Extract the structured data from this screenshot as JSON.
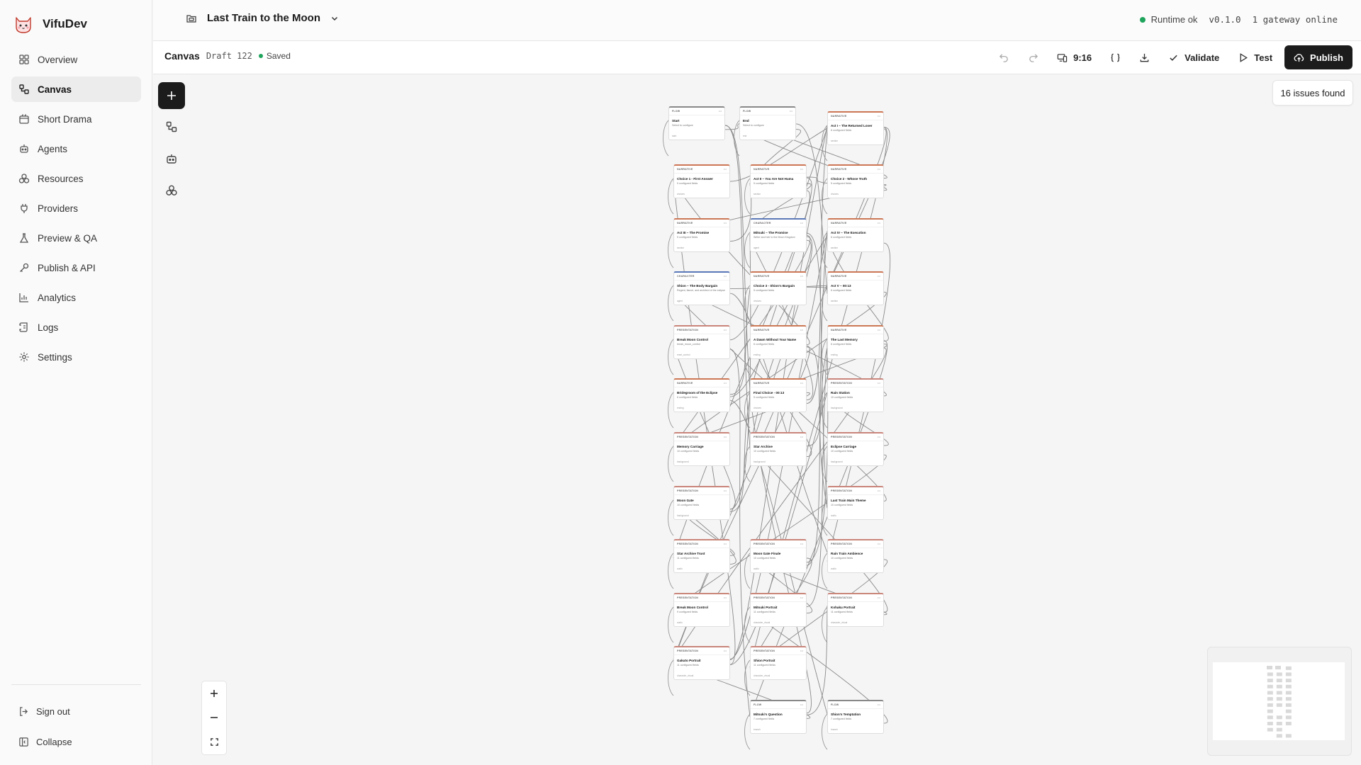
{
  "app": {
    "name": "VifuDev"
  },
  "sidebar": {
    "items": [
      {
        "label": "Overview",
        "icon": "grid-icon"
      },
      {
        "label": "Canvas",
        "icon": "workflow-icon",
        "active": true
      },
      {
        "label": "Short Drama",
        "icon": "film-icon"
      },
      {
        "label": "Agents",
        "icon": "bot-icon"
      },
      {
        "label": "Resources",
        "icon": "boxes-icon"
      },
      {
        "label": "Providers",
        "icon": "plug-icon"
      },
      {
        "label": "Preview & QA",
        "icon": "flask-icon"
      },
      {
        "label": "Publish & API",
        "icon": "key-icon"
      },
      {
        "label": "Analytics",
        "icon": "bar-chart-icon"
      },
      {
        "label": "Logs",
        "icon": "scroll-icon"
      },
      {
        "label": "Settings",
        "icon": "gear-icon"
      }
    ],
    "sign_out": "Sign out",
    "collapse": "Collapse"
  },
  "topbar": {
    "project_title": "Last Train to the Moon",
    "runtime_status": "Runtime ok",
    "version": "v0.1.0",
    "gateway": "1 gateway online"
  },
  "toolbar": {
    "title": "Canvas",
    "draft": "Draft 122",
    "saved": "Saved",
    "aspect": "9:16",
    "validate": "Validate",
    "test": "Test",
    "publish": "Publish"
  },
  "issues": "16 issues found",
  "colors": {
    "accent": "#1c1c1c",
    "ok": "#1fa45c",
    "narrative": "#cc7755",
    "character": "#5b78b8",
    "presentation": "#c9857a",
    "flow": "#888888"
  },
  "nodes": [
    {
      "type": "FLOW",
      "title": "Start",
      "sub": "Select to configure",
      "foot": "start"
    },
    {
      "type": "FLOW",
      "title": "End",
      "sub": "Select to configure",
      "foot": "end"
    },
    {
      "type": "NARRATIVE",
      "title": "Act I – The Returned Lover",
      "sub": "6 configured fields",
      "foot": "section"
    },
    {
      "type": "NARRATIVE",
      "title": "Choice 1 - First Answer",
      "sub": "5 configured fields",
      "foot": "choices"
    },
    {
      "type": "NARRATIVE",
      "title": "Act II – You Are Not Huma",
      "sub": "5 configured fields",
      "foot": "section"
    },
    {
      "type": "NARRATIVE",
      "title": "Choice 2 - Whose Truth",
      "sub": "5 configured fields",
      "foot": "choices"
    },
    {
      "type": "NARRATIVE",
      "title": "Act III – The Promise",
      "sub": "5 configured fields",
      "foot": "section"
    },
    {
      "type": "CHARACTER",
      "title": "Mitsuki – The Promise",
      "sub": "Writer and heir to the Moon Kingdom",
      "foot": "agent"
    },
    {
      "type": "NARRATIVE",
      "title": "Act IV – The Execution",
      "sub": "6 configured fields",
      "foot": "section"
    },
    {
      "type": "CHARACTER",
      "title": "Shion – The Body Bargain",
      "sub": "Regent, fiancé, and architect of the eclipse",
      "foot": "agent"
    },
    {
      "type": "NARRATIVE",
      "title": "Choice 3 - Shion's Bargain",
      "sub": "5 configured fields",
      "foot": "choices"
    },
    {
      "type": "NARRATIVE",
      "title": "Act V – 00:13",
      "sub": "6 configured fields",
      "foot": "section"
    },
    {
      "type": "PRESENTATION",
      "title": "Break Moon Control",
      "sub": "break_moon_control",
      "foot": "reset_control"
    },
    {
      "type": "NARRATIVE",
      "title": "A Dawn Without Your Name",
      "sub": "6 configured fields",
      "foot": "ending"
    },
    {
      "type": "NARRATIVE",
      "title": "The Last Memory",
      "sub": "6 configured fields",
      "foot": "ending"
    },
    {
      "type": "NARRATIVE",
      "title": "Bridegroom of the Eclipse",
      "sub": "6 configured fields",
      "foot": "ending"
    },
    {
      "type": "NARRATIVE",
      "title": "Final Choice - 00:13",
      "sub": "5 configured fields",
      "foot": "choices"
    },
    {
      "type": "PRESENTATION",
      "title": "Rain Station",
      "sub": "10 configured fields",
      "foot": "background"
    },
    {
      "type": "PRESENTATION",
      "title": "Memory Carriage",
      "sub": "10 configured fields",
      "foot": "background"
    },
    {
      "type": "PRESENTATION",
      "title": "Star Archive",
      "sub": "10 configured fields",
      "foot": "background"
    },
    {
      "type": "PRESENTATION",
      "title": "Eclipse Carriage",
      "sub": "10 configured fields",
      "foot": "background"
    },
    {
      "type": "PRESENTATION",
      "title": "Moon Gate",
      "sub": "10 configured fields",
      "foot": "background"
    },
    {
      "type": "PRESENTATION",
      "title": "Last Train Main Theme",
      "sub": "10 configured fields",
      "foot": "audio"
    },
    {
      "type": "PRESENTATION",
      "title": "Star Archive Trust",
      "sub": "11 configured fields",
      "foot": "audio"
    },
    {
      "type": "PRESENTATION",
      "title": "Moon Gate Finale",
      "sub": "10 configured fields",
      "foot": "audio"
    },
    {
      "type": "PRESENTATION",
      "title": "Rain Train Ambience",
      "sub": "10 configured fields",
      "foot": "audio"
    },
    {
      "type": "PRESENTATION",
      "title": "Break Moon Control",
      "sub": "9 configured fields",
      "foot": "audio"
    },
    {
      "type": "PRESENTATION",
      "title": "Mitsuki Portrait",
      "sub": "11 configured fields",
      "foot": "character_visual"
    },
    {
      "type": "PRESENTATION",
      "title": "Kohaku Portrait",
      "sub": "11 configured fields",
      "foot": "character_visual"
    },
    {
      "type": "PRESENTATION",
      "title": "Gakuto Portrait",
      "sub": "11 configured fields",
      "foot": "character_visual"
    },
    {
      "type": "PRESENTATION",
      "title": "Shion Portrait",
      "sub": "11 configured fields",
      "foot": "character_visual"
    },
    {
      "type": "FLOW",
      "title": "Mitsuki's Question",
      "sub": "7 configured fields",
      "foot": "branch"
    },
    {
      "type": "FLOW",
      "title": "Shion's Temptation",
      "sub": "7 configured fields",
      "foot": "branch"
    }
  ]
}
